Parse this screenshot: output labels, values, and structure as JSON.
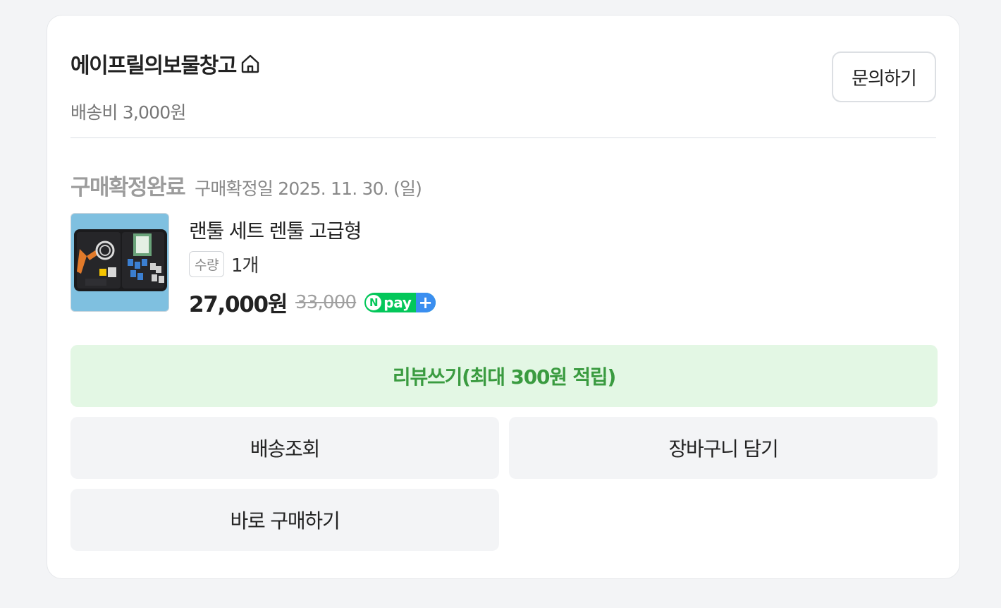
{
  "store": {
    "name": "에이프릴의보물창고",
    "home_icon": "home-icon",
    "shipping_fee": "배송비 3,000원",
    "inquiry_label": "문의하기"
  },
  "order": {
    "status": "구매확정완료",
    "confirm_date": "구매확정일 2025. 11. 30. (일)"
  },
  "product": {
    "name": "랜툴 세트 렌툴 고급형",
    "qty_label": "수량",
    "qty_value": "1개",
    "price": "27,000원",
    "original_price": "33,000",
    "npay": {
      "n": "N",
      "text": "pay",
      "plus": "+"
    }
  },
  "actions": {
    "review": "리뷰쓰기(최대 300원 적립)",
    "tracking": "배송조회",
    "cart": "장바구니 담기",
    "buy_now": "바로 구매하기"
  },
  "colors": {
    "background": "#f3f4f6",
    "review_bg": "#e3f7e4",
    "review_text": "#3a9b40",
    "npay_green": "#03c75a",
    "npay_blue": "#3a8ef0"
  }
}
